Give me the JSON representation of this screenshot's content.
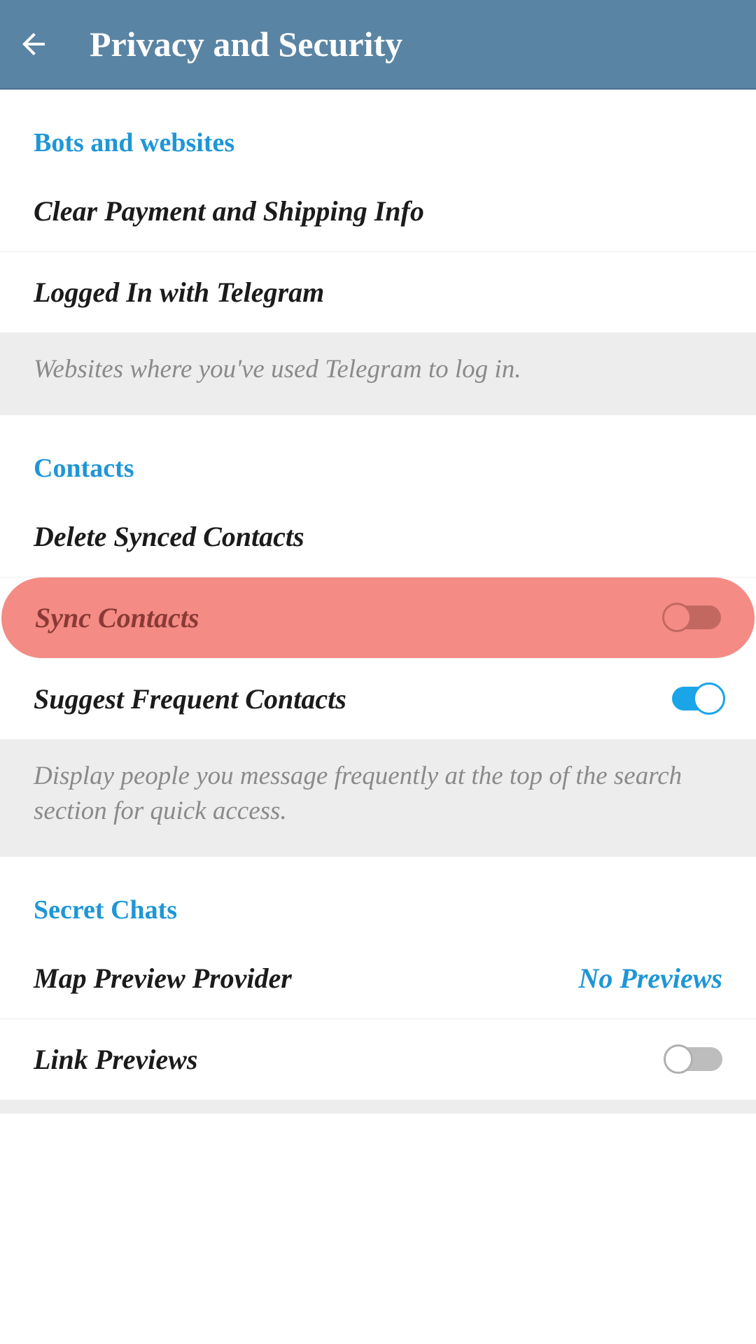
{
  "header": {
    "title": "Privacy and Security"
  },
  "sections": {
    "bots": {
      "title": "Bots and websites",
      "clear_payment": "Clear Payment and Shipping Info",
      "logged_in": "Logged In with Telegram",
      "note": "Websites where you've used Telegram to log in."
    },
    "contacts": {
      "title": "Contacts",
      "delete_synced": "Delete Synced Contacts",
      "sync_contacts": "Sync Contacts",
      "suggest_frequent": "Suggest Frequent Contacts",
      "note": "Display people you message frequently at the top of the search section for quick access."
    },
    "secret": {
      "title": "Secret Chats",
      "map_provider": "Map Preview Provider",
      "map_provider_value": "No Previews",
      "link_previews": "Link Previews"
    }
  }
}
